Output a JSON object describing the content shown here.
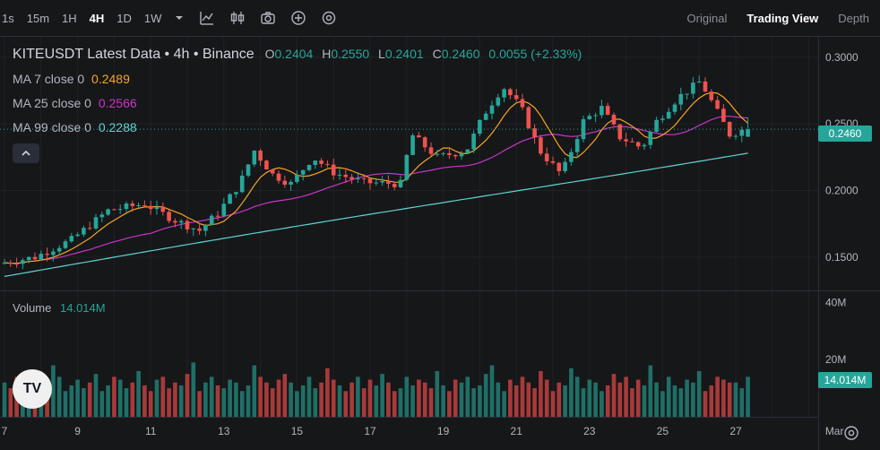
{
  "toolbar": {
    "timeframes": [
      "1s",
      "15m",
      "1H",
      "4H",
      "1D",
      "1W"
    ],
    "active_timeframe": "4H",
    "icons": [
      "chevron-down-icon",
      "indicator-icon",
      "candle-type-icon",
      "camera-icon",
      "add-icon",
      "settings-icon"
    ],
    "views": [
      "Original",
      "Trading View",
      "Depth"
    ],
    "active_view": "Trading View"
  },
  "legend": {
    "title": "KITEUSDT Latest Data • 4h • Binance",
    "o_label": "O",
    "o": "0.2404",
    "h_label": "H",
    "h": "0.2550",
    "l_label": "L",
    "l": "0.2401",
    "c_label": "C",
    "c": "0.2460",
    "change": "0.0055 (+2.33%)",
    "ma7_label": "MA 7 close 0",
    "ma7": "0.2489",
    "ma25_label": "MA 25 close 0",
    "ma25": "0.2566",
    "ma99_label": "MA 99 close 0",
    "ma99": "0.2288"
  },
  "volume": {
    "label": "Volume",
    "value": "14.014M"
  },
  "price_axis": {
    "ticks": [
      "0.3000",
      "0.2500",
      "0.2000",
      "0.1500"
    ],
    "last_price": "0.2460"
  },
  "volume_axis": {
    "ticks": [
      "40M",
      "20M"
    ],
    "last_volume": "14.014M"
  },
  "time_axis": {
    "ticks": [
      "7",
      "9",
      "11",
      "13",
      "15",
      "17",
      "19",
      "21",
      "23",
      "25",
      "27",
      "Mar"
    ]
  },
  "colors": {
    "up": "#26a69a",
    "down": "#ef5350",
    "ma7": "#f5a623",
    "ma25": "#c935c9",
    "ma99": "#5fd3d0",
    "background": "#161719"
  },
  "chart_data": {
    "type": "candlestick",
    "symbol": "KITEUSDT",
    "interval": "4h",
    "ylim": [
      0.125,
      0.31
    ],
    "anchors": [
      {
        "day": 7,
        "price": 0.145
      },
      {
        "day": 8,
        "price": 0.15
      },
      {
        "day": 9,
        "price": 0.163
      },
      {
        "day": 10,
        "price": 0.185
      },
      {
        "day": 11,
        "price": 0.19
      },
      {
        "day": 11.8,
        "price": 0.178
      },
      {
        "day": 12.5,
        "price": 0.17
      },
      {
        "day": 13,
        "price": 0.183
      },
      {
        "day": 13.6,
        "price": 0.205
      },
      {
        "day": 14,
        "price": 0.23
      },
      {
        "day": 14.5,
        "price": 0.212
      },
      {
        "day": 15,
        "price": 0.205
      },
      {
        "day": 15.6,
        "price": 0.225
      },
      {
        "day": 16.2,
        "price": 0.213
      },
      {
        "day": 17,
        "price": 0.206
      },
      {
        "day": 18,
        "price": 0.205
      },
      {
        "day": 18.3,
        "price": 0.242
      },
      {
        "day": 19,
        "price": 0.225
      },
      {
        "day": 19.8,
        "price": 0.23
      },
      {
        "day": 20.3,
        "price": 0.258
      },
      {
        "day": 20.8,
        "price": 0.278
      },
      {
        "day": 21.3,
        "price": 0.262
      },
      {
        "day": 21.8,
        "price": 0.23
      },
      {
        "day": 22.4,
        "price": 0.212
      },
      {
        "day": 23,
        "price": 0.252
      },
      {
        "day": 23.5,
        "price": 0.262
      },
      {
        "day": 24,
        "price": 0.24
      },
      {
        "day": 24.6,
        "price": 0.232
      },
      {
        "day": 25,
        "price": 0.252
      },
      {
        "day": 25.6,
        "price": 0.27
      },
      {
        "day": 26.2,
        "price": 0.282
      },
      {
        "day": 26.6,
        "price": 0.262
      },
      {
        "day": 27,
        "price": 0.242
      },
      {
        "day": 27.4,
        "price": 0.246
      }
    ],
    "volume_bars": [
      12,
      10,
      14,
      9,
      16,
      11,
      10,
      12,
      18,
      14,
      9,
      11,
      13,
      10,
      12,
      15,
      9,
      11,
      14,
      13,
      10,
      12,
      16,
      11,
      9,
      13,
      14,
      10,
      12,
      11,
      15,
      19,
      9,
      12,
      14,
      11,
      10,
      13,
      12,
      9,
      11,
      18,
      14,
      12,
      10,
      13,
      15,
      12,
      9,
      11,
      14,
      10,
      12,
      17,
      13,
      11,
      9,
      12,
      14,
      10,
      13,
      11,
      15,
      12,
      9,
      10,
      14,
      11,
      13,
      12,
      10,
      16,
      11,
      9,
      13,
      12,
      14,
      10,
      11,
      15,
      18,
      12,
      9,
      13,
      11,
      14,
      12,
      10,
      16,
      13,
      9,
      12,
      11,
      17,
      14,
      10,
      13,
      12,
      9,
      11,
      15,
      12,
      14,
      10,
      13,
      11,
      18,
      12,
      9,
      14,
      11,
      10,
      13,
      12,
      16,
      9,
      11,
      14,
      13,
      12
    ],
    "last_close": 0.246,
    "last_volume_m": 14.014
  }
}
